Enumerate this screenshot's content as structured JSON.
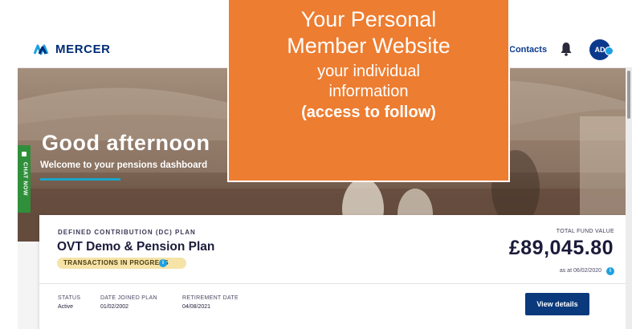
{
  "callout": {
    "title_line1": "Your Personal",
    "title_line2": "Member Website",
    "sub_line1": "your individual",
    "sub_line2": "information",
    "note": "(access to follow)"
  },
  "header": {
    "brand": "MERCER",
    "contacts_label": "Contacts",
    "avatar_initials": "AD",
    "icons": [
      "mercer-logo-icon",
      "bell-icon",
      "chevron-down-icon"
    ]
  },
  "hero": {
    "greeting": "Good afternoon",
    "welcome": "Welcome to your pensions dashboard"
  },
  "chat": {
    "label": "CHAT NOW"
  },
  "plan": {
    "type_label": "DEFINED CONTRIBUTION (DC) PLAN",
    "name": "OVT Demo & Pension Plan",
    "status_badge": "TRANSACTIONS IN PROGRESS",
    "total_fund_label": "TOTAL FUND VALUE",
    "total_fund_value": "£89,045.80",
    "value_date": "as at 06/02/2020",
    "status_label": "STATUS",
    "status_value": "Active",
    "joined_label": "DATE JOINED PLAN",
    "joined_value": "01/02/2002",
    "retirement_label": "RETIREMENT DATE",
    "retirement_value": "04/08/2021",
    "view_details_label": "View details"
  },
  "colors": {
    "callout_orange": "#ed7d31",
    "mercer_navy": "#002c77",
    "button_navy": "#0b3a7c",
    "info_blue": "#1ea0e0",
    "chat_green": "#2f8f3a",
    "badge_yellow": "#f5e3a8"
  }
}
